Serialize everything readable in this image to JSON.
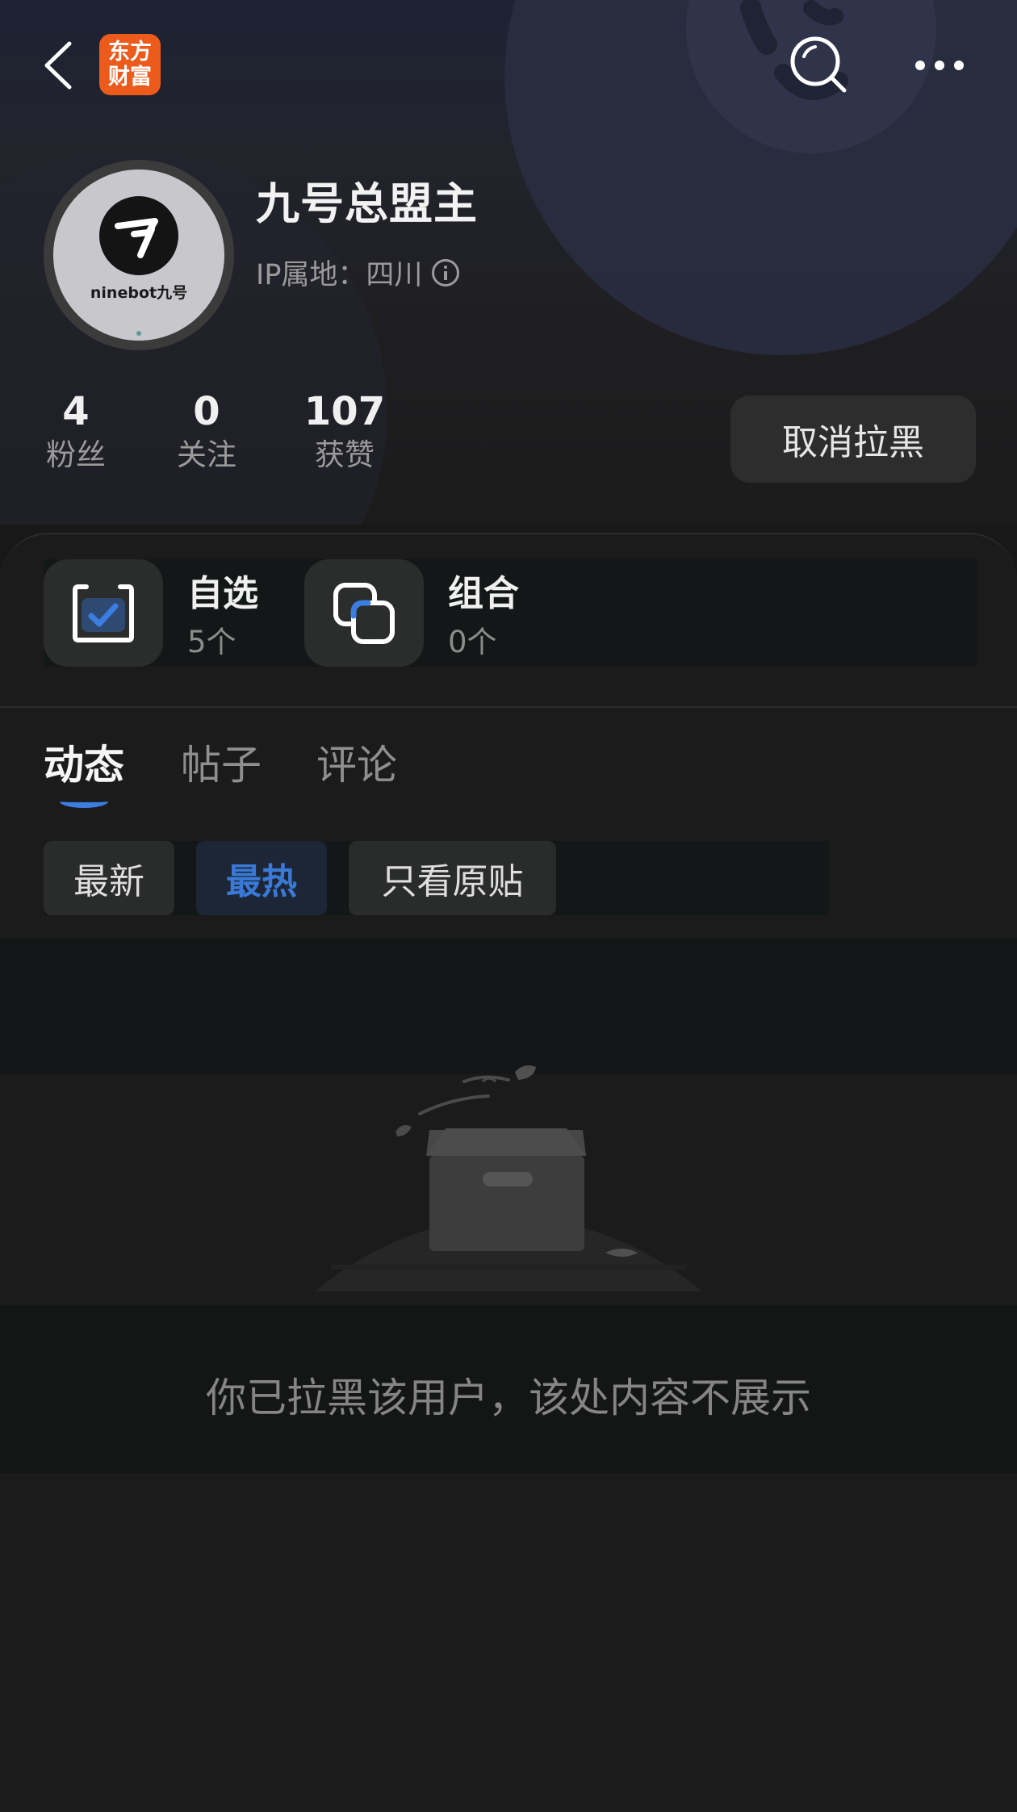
{
  "header": {
    "brand_logo_text_line1": "东方",
    "brand_logo_text_line2": "财富",
    "icons": {
      "back": "back-arrow-icon",
      "search": "search-icon",
      "more": "more-icon"
    }
  },
  "profile": {
    "avatar_brand_text": "ninebot九号",
    "username": "九号总盟主",
    "ip_location": "IP属地：四川",
    "stats": [
      {
        "value": "4",
        "label": "粉丝"
      },
      {
        "value": "0",
        "label": "关注"
      },
      {
        "value": "107",
        "label": "获赞"
      }
    ],
    "unblock_button_label": "取消拉黑"
  },
  "quick_links": [
    {
      "title": "自选",
      "count": "5个",
      "icon": "watchlist-check-icon"
    },
    {
      "title": "组合",
      "count": "0个",
      "icon": "portfolio-stack-icon"
    }
  ],
  "tabs": [
    {
      "label": "动态",
      "active": true
    },
    {
      "label": "帖子",
      "active": false
    },
    {
      "label": "评论",
      "active": false
    }
  ],
  "filters": [
    {
      "label": "最新",
      "selected": false
    },
    {
      "label": "最热",
      "selected": true
    },
    {
      "label": "只看原贴",
      "selected": false
    }
  ],
  "empty_state": {
    "message": "你已拉黑该用户，该处内容不展示",
    "illustration": "empty-box-illustration"
  },
  "colors": {
    "accent_blue": "#3b7de0",
    "brand_orange": "#ec5a1c",
    "background": "#181818"
  }
}
